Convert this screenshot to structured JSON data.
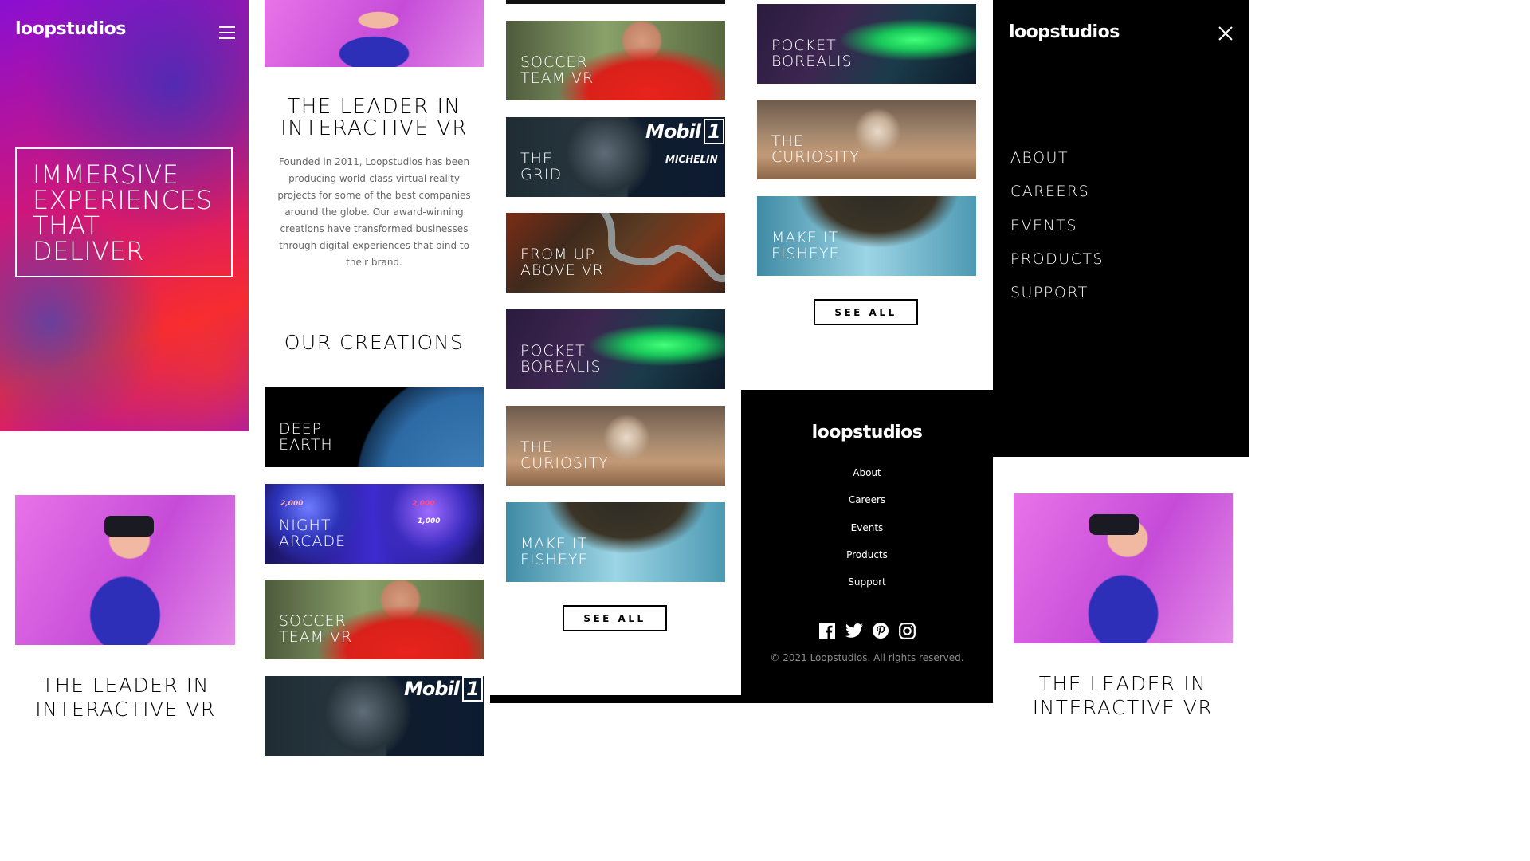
{
  "brand": {
    "logo": "loopstudios"
  },
  "hero": {
    "lines": [
      "IMMERSIVE",
      "EXPERIENCES",
      "THAT",
      "DELIVER"
    ]
  },
  "intro": {
    "heading_line1": "THE LEADER IN",
    "heading_line2": "INTERACTIVE VR",
    "paragraph_lines": [
      "Founded in 2011, Loopstudios has been",
      "producing world-class virtual reality",
      "projects for some of the best companies",
      "around the globe. Our award-winning",
      "creations have transformed businesses",
      "through digital experiences that bind to",
      "their brand."
    ]
  },
  "creations": {
    "heading": "OUR CREATIONS",
    "see_all": "SEE ALL",
    "tiles": {
      "deep_earth": [
        "DEEP",
        "EARTH"
      ],
      "night_arcade": [
        "NIGHT",
        "ARCADE"
      ],
      "soccer_team": [
        "SOCCER",
        "TEAM VR"
      ],
      "the_grid": [
        "THE",
        "GRID"
      ],
      "from_up_above": [
        "FROM UP",
        "ABOVE VR"
      ],
      "pocket_borealis": [
        "POCKET",
        "BOREALIS"
      ],
      "the_curiosity": [
        "THE",
        "CURIOSITY"
      ],
      "make_it_fisheye": [
        "MAKE IT",
        "FISHEYE"
      ]
    },
    "mobil_text": "Mobil",
    "mobil_num": "1",
    "michelin_text": "MICHELIN",
    "arcade_labels": [
      "2,000",
      "2,000",
      "1,000"
    ]
  },
  "footer": {
    "links": [
      "About",
      "Careers",
      "Events",
      "Products",
      "Support"
    ],
    "copyright": "© 2021 Loopstudios. All rights reserved.",
    "social": [
      "facebook-icon",
      "twitter-icon",
      "pinterest-icon",
      "instagram-icon"
    ]
  },
  "mobile_menu": {
    "items": [
      "ABOUT",
      "CAREERS",
      "EVENTS",
      "PRODUCTS",
      "SUPPORT"
    ]
  },
  "colors": {
    "black": "#000000",
    "white": "#ffffff",
    "muted_text": "#666666"
  }
}
